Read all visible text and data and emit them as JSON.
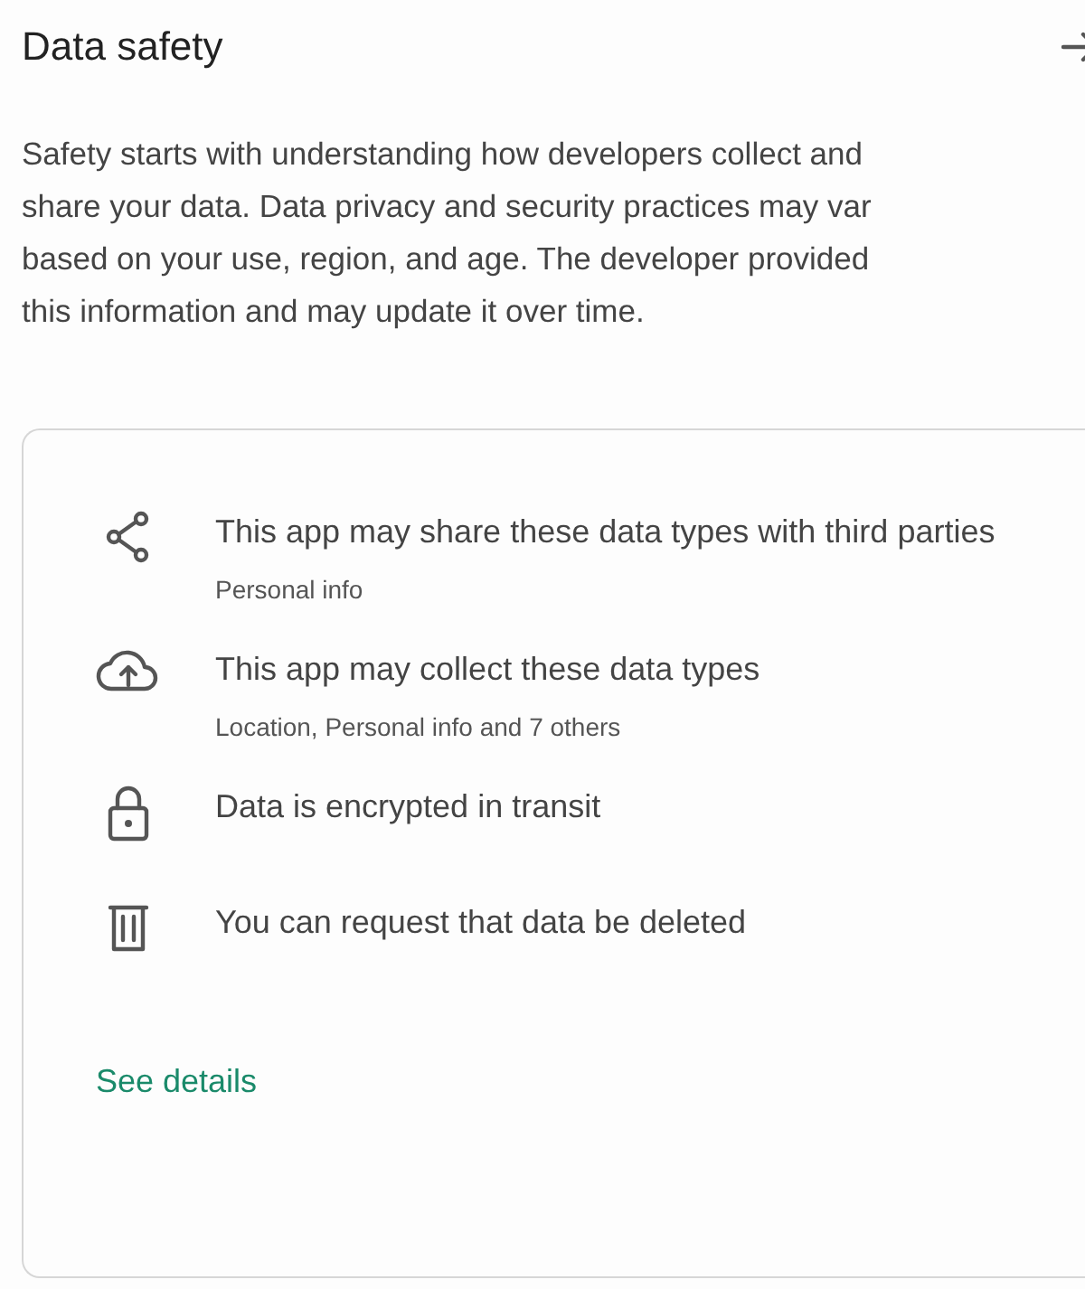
{
  "header": {
    "title": "Data safety"
  },
  "description_lines": [
    "Safety starts with understanding how developers collect and",
    "share your data. Data privacy and security practices may var",
    "based on your use, region, and age. The developer provided",
    "this information and may update it over time."
  ],
  "items": [
    {
      "kind": "share",
      "title": "This app may share these data types with third parties",
      "subtitle": "Personal info"
    },
    {
      "kind": "cloud",
      "title": "This app may collect these data types",
      "subtitle": "Location, Personal info and 7 others"
    },
    {
      "kind": "lock",
      "title": "Data is encrypted in transit"
    },
    {
      "kind": "trash",
      "title": "You can request that data be deleted"
    }
  ],
  "link": "See details"
}
